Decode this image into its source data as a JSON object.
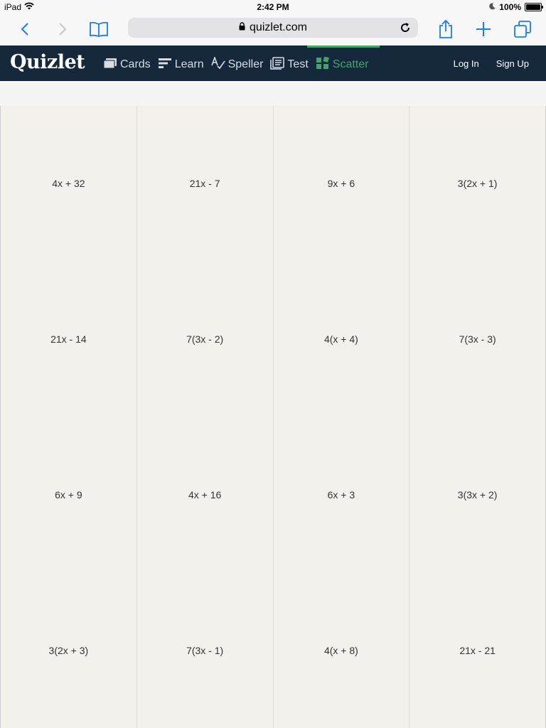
{
  "status_bar": {
    "device": "iPad",
    "time": "2:42 PM",
    "battery": "100%"
  },
  "browser": {
    "url": "quizlet.com",
    "icons": [
      "back-icon",
      "forward-icon",
      "bookmarks-icon",
      "lock-icon",
      "reload-icon",
      "share-icon",
      "new-tab-icon",
      "tabs-icon"
    ]
  },
  "header": {
    "logo": "Quizlet",
    "nav": [
      {
        "label": "Cards",
        "icon": "cards-icon"
      },
      {
        "label": "Learn",
        "icon": "learn-icon"
      },
      {
        "label": "Speller",
        "icon": "speller-icon"
      },
      {
        "label": "Test",
        "icon": "test-icon"
      },
      {
        "label": "Scatter",
        "icon": "scatter-icon",
        "active": true
      }
    ],
    "login": "Log In",
    "signup": "Sign Up",
    "colors": {
      "bg": "#15283c",
      "active": "#3ea66a"
    }
  },
  "cards": [
    "4x + 32",
    "21x - 7",
    "9x + 6",
    "3(2x + 1)",
    "21x - 14",
    "7(3x - 2)",
    "4(x + 4)",
    "7(3x - 3)",
    "6x + 9",
    "4x + 16",
    "6x + 3",
    "3(3x + 2)",
    "3(2x + 3)",
    "7(3x - 1)",
    "4(x + 8)",
    "21x - 21"
  ]
}
